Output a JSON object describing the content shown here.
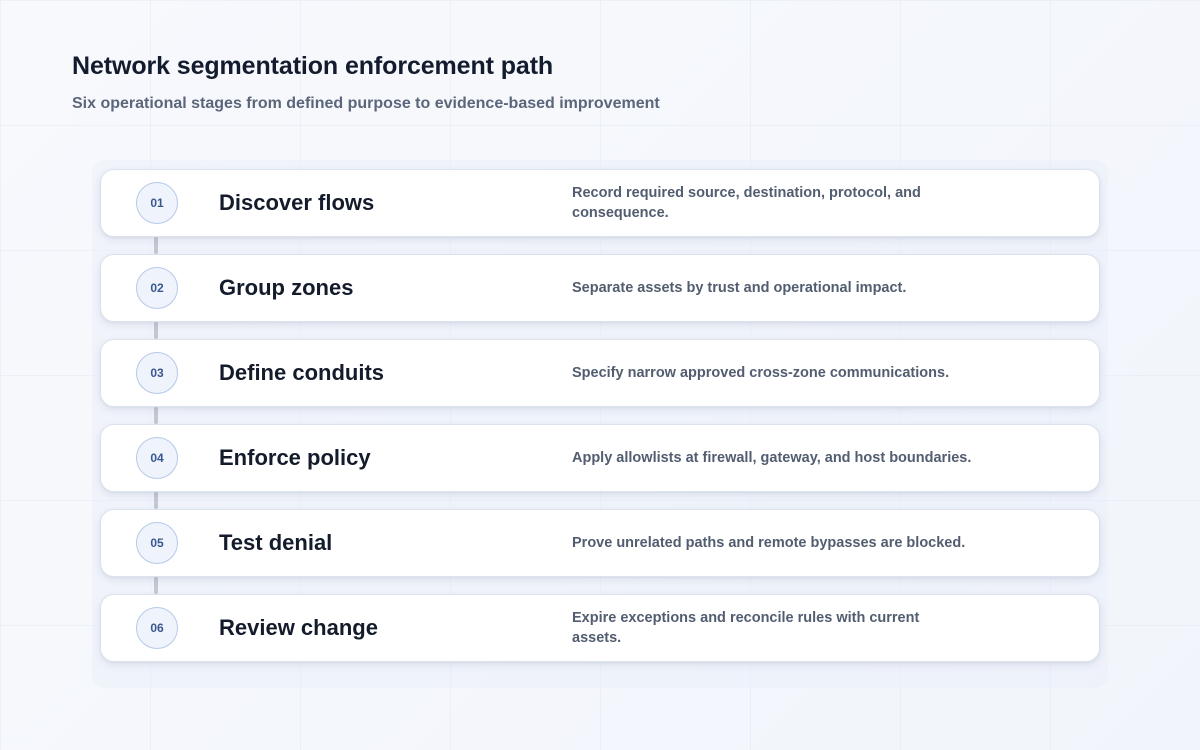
{
  "header": {
    "title": "Network segmentation enforcement path",
    "subtitle": "Six operational stages from defined purpose to evidence-based improvement"
  },
  "stages": [
    {
      "number": "01",
      "title": "Discover flows",
      "description": "Record required source, destination, protocol, and consequence."
    },
    {
      "number": "02",
      "title": "Group zones",
      "description": "Separate assets by trust and operational impact."
    },
    {
      "number": "03",
      "title": "Define conduits",
      "description": "Specify narrow approved cross-zone communications."
    },
    {
      "number": "04",
      "title": "Enforce policy",
      "description": "Apply allowlists at firewall, gateway, and host boundaries."
    },
    {
      "number": "05",
      "title": "Test denial",
      "description": "Prove unrelated paths and remote bypasses are blocked."
    },
    {
      "number": "06",
      "title": "Review change",
      "description": "Expire exceptions and reconcile rules with current assets."
    }
  ]
}
